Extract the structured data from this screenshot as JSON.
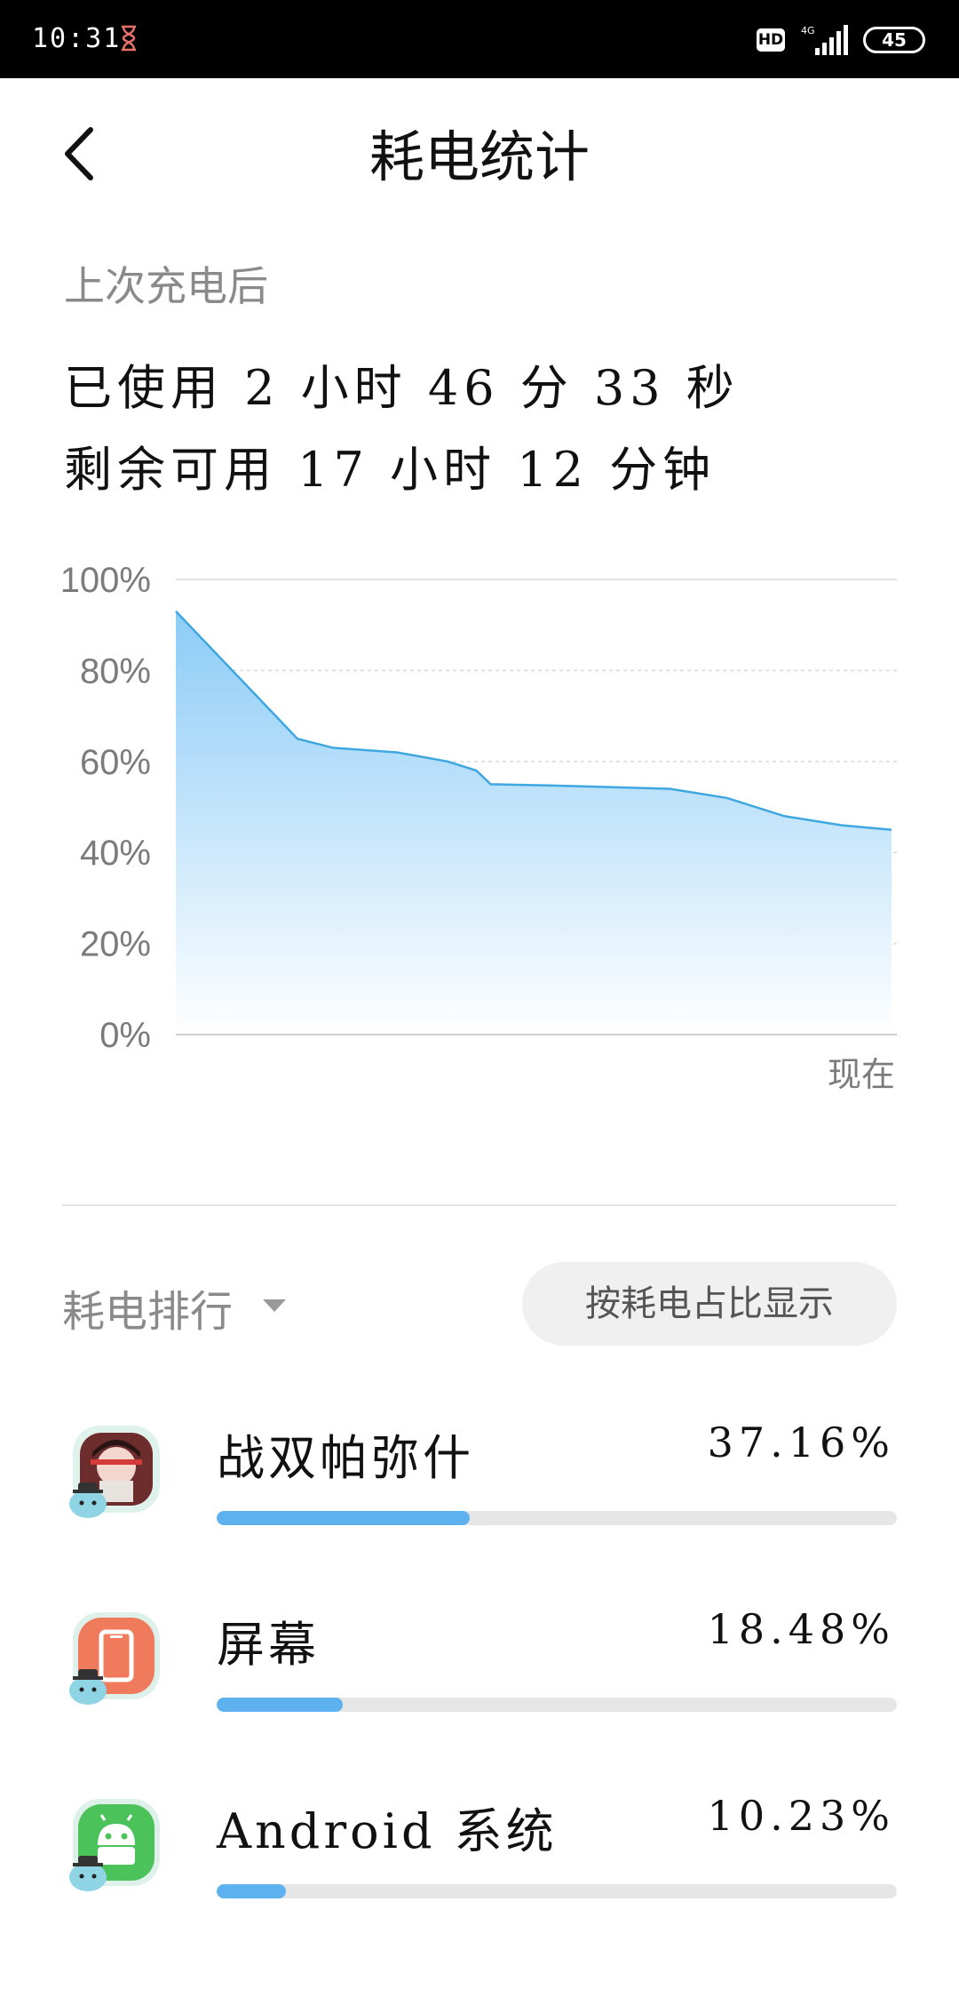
{
  "status_bar": {
    "time": "10:31",
    "hd_label": "HD",
    "network_label": "4G",
    "battery_level": "45"
  },
  "header": {
    "title": "耗电统计"
  },
  "summary": {
    "since_label": "上次充电后",
    "used_text": "已使用 2 小时 46 分 33 秒",
    "remaining_text": "剩余可用 17 小时 12 分钟"
  },
  "chart_data": {
    "type": "area",
    "ylim": [
      0,
      100
    ],
    "y_ticks": [
      "100%",
      "80%",
      "60%",
      "40%",
      "20%",
      "0%"
    ],
    "x_end_label": "现在",
    "series": [
      {
        "x": [
          0,
          0.17,
          0.22,
          0.31,
          0.38,
          0.42,
          0.44,
          0.53,
          0.69,
          0.77,
          0.85,
          0.93,
          1.0
        ],
        "values": [
          93,
          65,
          63,
          62,
          60,
          58,
          55,
          54.7,
          54,
          52,
          48,
          46,
          45
        ]
      }
    ],
    "colors": {
      "line": "#3fa7e0",
      "fill_top": "#8cccf7",
      "fill_bottom": "#ffffff",
      "grid": "#d9d9d9"
    },
    "grid": true
  },
  "ranking": {
    "label": "耗电排行",
    "sort_toggle_label": "按耗电占比显示",
    "items": [
      {
        "name": "战双帕弥什",
        "percent": "37.16%",
        "fraction": 0.3716,
        "icon": "game-character-icon"
      },
      {
        "name": "屏幕",
        "percent": "18.48%",
        "fraction": 0.1848,
        "icon": "screen-icon"
      },
      {
        "name": "Android 系统",
        "percent": "10.23%",
        "fraction": 0.1023,
        "icon": "android-icon"
      }
    ]
  }
}
